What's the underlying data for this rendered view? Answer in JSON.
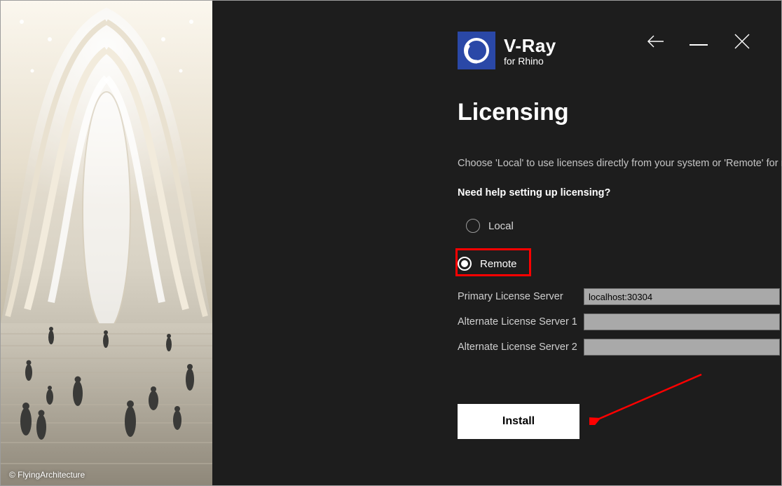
{
  "image_credit": "© FlyingArchitecture",
  "logo": {
    "brand": "V-Ray",
    "sub": "for Rhino"
  },
  "page_title": "Licensing",
  "description": "Choose 'Local' to use licenses directly from your system or 'Remote' for network licenses.",
  "help_link": "Need help setting up licensing?",
  "radios": {
    "local": "Local",
    "remote": "Remote",
    "selected": "remote"
  },
  "fields": {
    "primary_label": "Primary License Server",
    "primary_value": "localhost:30304",
    "alt1_label": "Alternate License Server 1",
    "alt1_value": "",
    "alt2_label": "Alternate License Server 2",
    "alt2_value": ""
  },
  "install_label": "Install"
}
